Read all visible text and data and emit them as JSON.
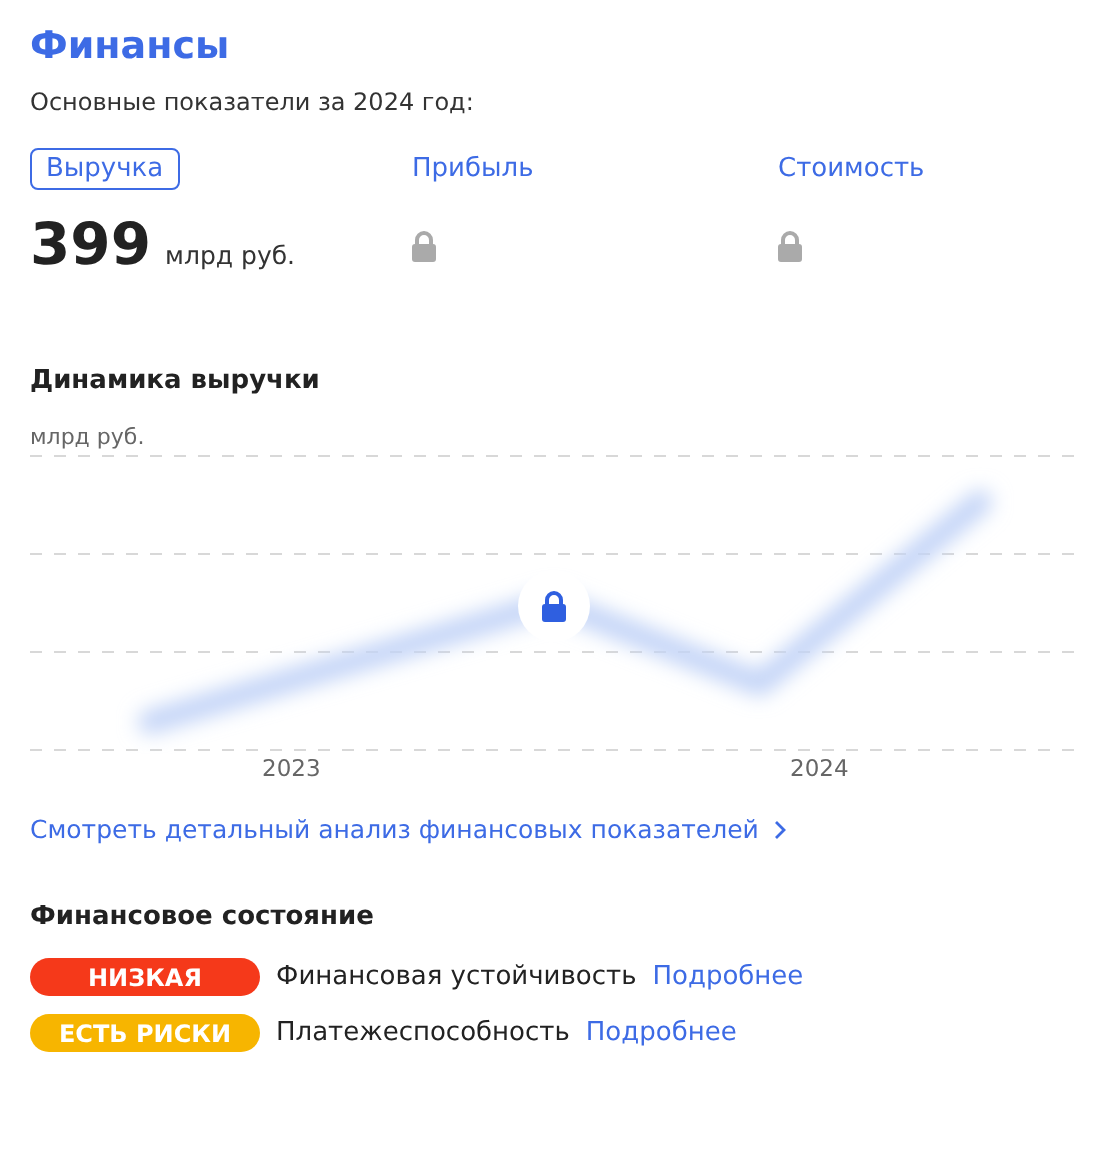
{
  "title": "Финансы",
  "subtitle": "Основные показатели за 2024 год:",
  "metrics": [
    {
      "label": "Выручка",
      "selected": true,
      "locked": false,
      "value": "399",
      "unit": "млрд руб."
    },
    {
      "label": "Прибыль",
      "selected": false,
      "locked": true
    },
    {
      "label": "Стоимость",
      "selected": false,
      "locked": true
    }
  ],
  "chart": {
    "title": "Динамика выручки",
    "unit": "млрд руб.",
    "locked": true,
    "x_labels": [
      "2023",
      "2024"
    ]
  },
  "detail_link": "Смотреть детальный анализ финансовых показателей",
  "status": {
    "title": "Финансовое состояние",
    "items": [
      {
        "badge": "НИЗКАЯ",
        "color": "#f5391a",
        "label": "Финансовая устойчивость",
        "link": "Подробнее"
      },
      {
        "badge": "ЕСТЬ РИСКИ",
        "color": "#f7b500",
        "label": "Платежеспособность",
        "link": "Подробнее"
      }
    ]
  }
}
